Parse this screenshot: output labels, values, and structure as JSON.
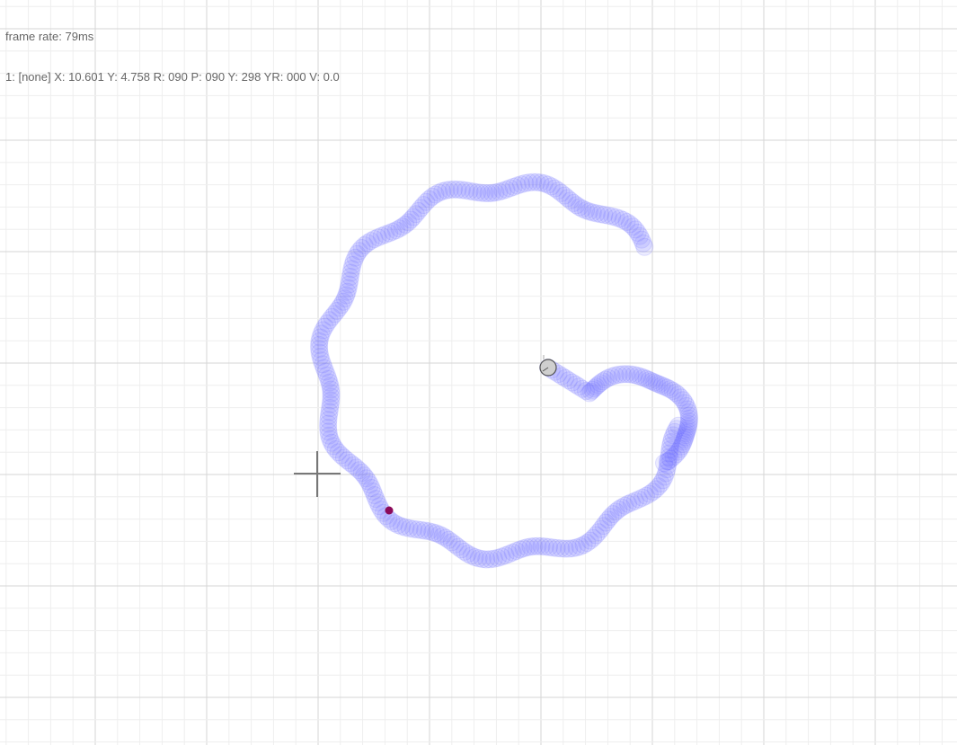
{
  "hud": {
    "frame_rate_label": "frame rate:",
    "frame_rate_value": "79ms",
    "status_line": "1: [none] X: 10.601 Y: 4.758 R: 090 P: 090 Y: 298 YR: 000 V: 0.0"
  },
  "colors": {
    "background": "#ffffff",
    "grid_minor": "#eeeeee",
    "grid_major": "#d6d6d6",
    "trail": "#6b6bff",
    "cursor": "#777777",
    "robot_fill": "#cfcfcf",
    "robot_stroke": "#555555",
    "marker": "#8b0a5a"
  },
  "icons": {
    "crosshair": "crosshair-icon",
    "robot": "robot-turtle-icon",
    "marker": "target-dot-icon"
  }
}
